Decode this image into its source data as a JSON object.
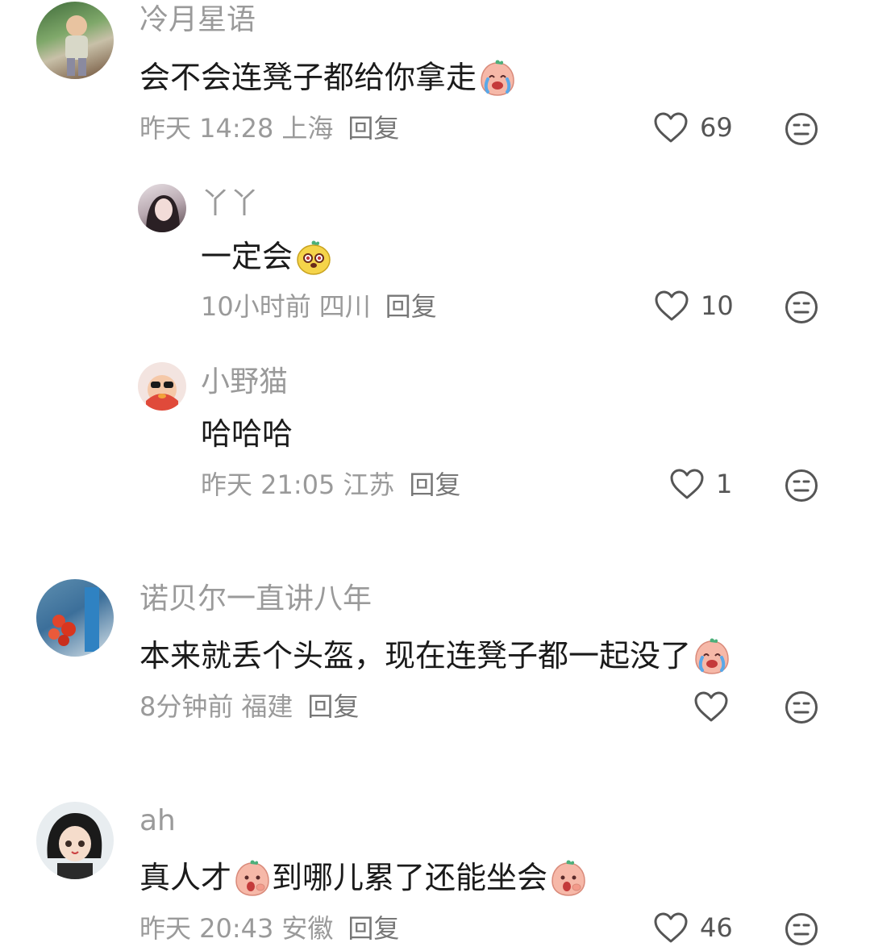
{
  "comments": [
    {
      "username": "冷月星语",
      "text": "会不会连凳子都给你拿走",
      "time": "昨天 14:28",
      "location": "上海",
      "reply_label": "回复",
      "likes": "69",
      "replies": [
        {
          "username": "丫丫",
          "text": "一定会",
          "time": "10小时前",
          "location": "四川",
          "reply_label": "回复",
          "likes": "10"
        },
        {
          "username": "小野猫",
          "text": "哈哈哈",
          "time": "昨天 21:05",
          "location": "江苏",
          "reply_label": "回复",
          "likes": "1"
        }
      ]
    },
    {
      "username": "诺贝尔一直讲八年",
      "text": "本来就丢个头盔，现在连凳子都一起没了",
      "time": "8分钟前",
      "location": "福建",
      "reply_label": "回复",
      "likes": ""
    },
    {
      "username": "ah",
      "text_part1": "真人才",
      "text_part2": "到哪儿累了还能坐会",
      "time": "昨天 20:43",
      "location": "安徽",
      "reply_label": "回复",
      "likes": "46"
    }
  ],
  "icons": {
    "like": "heart-outline-icon",
    "dislike": "meh-face-icon",
    "emoji_cry": "crying-peach-emoji",
    "emoji_dog": "yellow-dog-emoji",
    "emoji_shock": "shocked-peach-emoji"
  },
  "colors": {
    "text_primary": "#1a1a1a",
    "text_secondary": "#9a9a9a",
    "icon": "#555555"
  }
}
